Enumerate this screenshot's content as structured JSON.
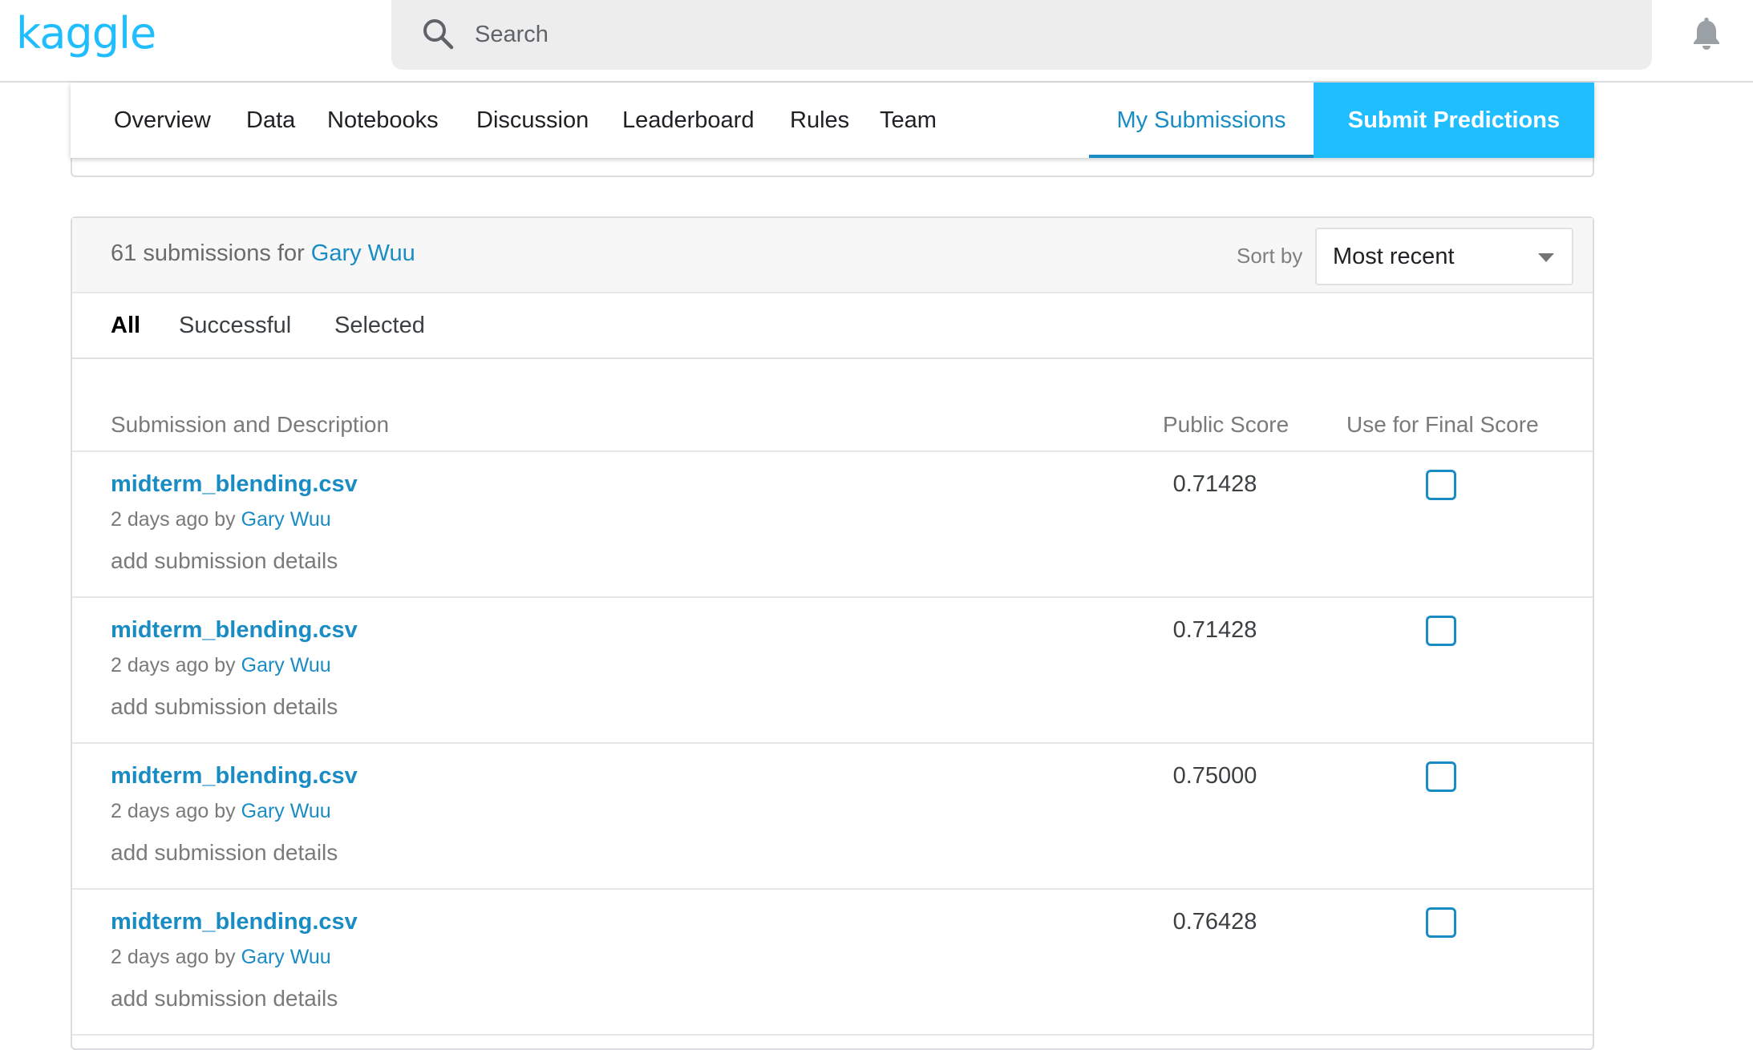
{
  "header": {
    "logo": "kaggle",
    "search_placeholder": "Search"
  },
  "nav": {
    "tabs": [
      "Overview",
      "Data",
      "Notebooks",
      "Discussion",
      "Leaderboard",
      "Rules",
      "Team"
    ],
    "my_submissions": "My Submissions",
    "submit_predictions": "Submit Predictions"
  },
  "panel": {
    "count_text": "61 submissions for",
    "user": "Gary Wuu",
    "sort_label": "Sort by",
    "sort_value": "Most recent",
    "filters": [
      "All",
      "Successful",
      "Selected"
    ],
    "columns": {
      "submission": "Submission and Description",
      "score": "Public Score",
      "final": "Use for Final Score"
    }
  },
  "submissions": [
    {
      "file": "midterm_blending.csv",
      "time": "2 days ago by",
      "author": "Gary Wuu",
      "details": "add submission details",
      "score": "0.71428",
      "selected": false
    },
    {
      "file": "midterm_blending.csv",
      "time": "2 days ago by",
      "author": "Gary Wuu",
      "details": "add submission details",
      "score": "0.71428",
      "selected": false
    },
    {
      "file": "midterm_blending.csv",
      "time": "2 days ago by",
      "author": "Gary Wuu",
      "details": "add submission details",
      "score": "0.75000",
      "selected": false
    },
    {
      "file": "midterm_blending.csv",
      "time": "2 days ago by",
      "author": "Gary Wuu",
      "details": "add submission details",
      "score": "0.76428",
      "selected": false
    }
  ],
  "colors": {
    "brand": "#20BEFF",
    "link": "#1a8cc4"
  },
  "icons": {
    "search": "search-icon",
    "notifications": "bell-icon",
    "sort": "caret-down-icon"
  }
}
